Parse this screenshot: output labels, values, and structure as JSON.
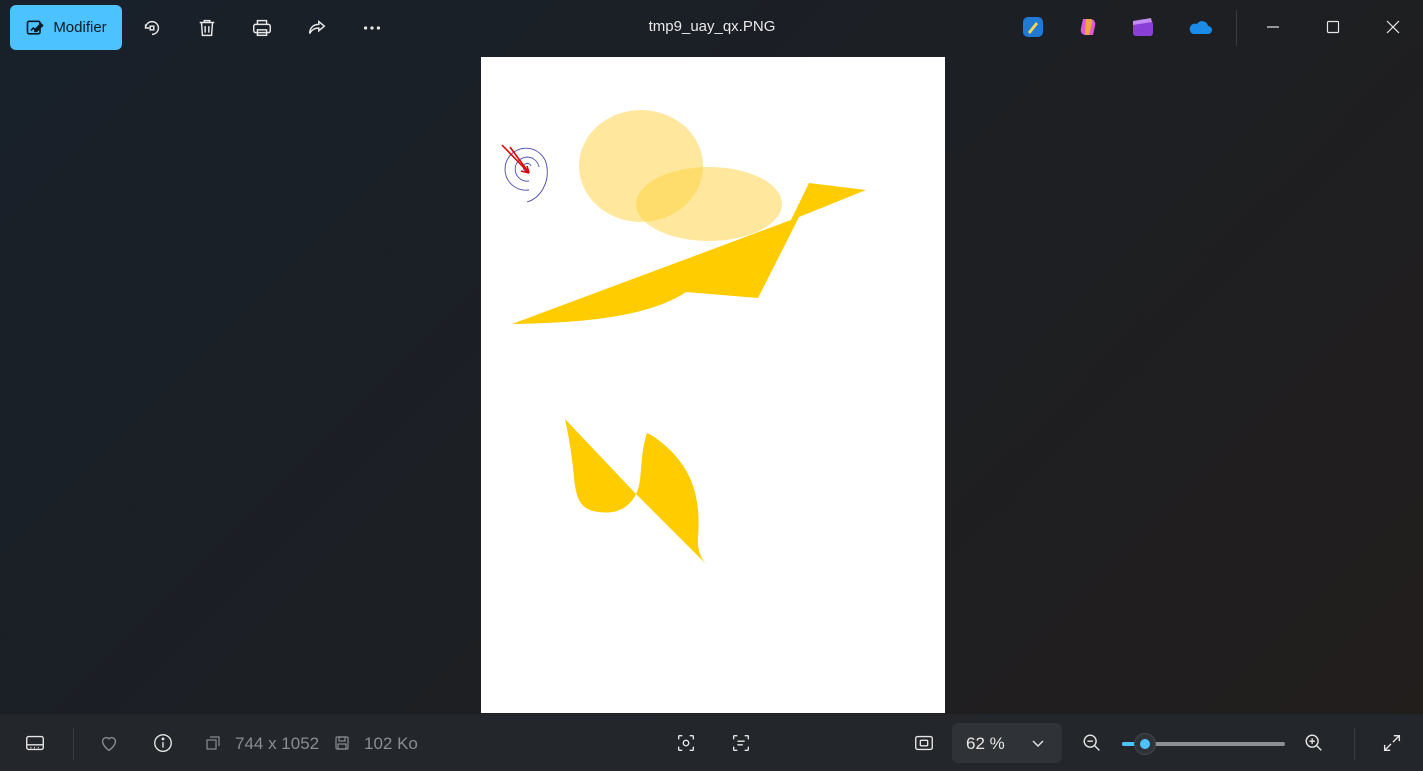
{
  "toolbar": {
    "edit_label": "Modifier",
    "filename": "tmp9_uay_qx.PNG"
  },
  "status": {
    "dimensions": "744 x 1052",
    "file_size": "102 Ko",
    "zoom": "62 %",
    "zoom_fraction": 0.14
  },
  "colors": {
    "accent": "#4cc2ff",
    "shape_yellow": "#ffcc00",
    "ellipse_fill": "#ffe58a",
    "spiral": "#4a4ab0",
    "arrow": "#e00000"
  },
  "icons": [
    "edit-image-icon",
    "rotate-icon",
    "delete-icon",
    "print-icon",
    "share-icon",
    "more-icon",
    "paint-app-icon",
    "copilot-app-icon",
    "clipchamp-app-icon",
    "onedrive-icon",
    "minimize-icon",
    "maximize-icon",
    "close-icon",
    "filmstrip-icon",
    "favorite-icon",
    "info-icon",
    "resolution-icon",
    "disk-icon",
    "visual-search-icon",
    "text-scan-icon",
    "fit-to-window-icon",
    "chevron-down-icon",
    "zoom-out-icon",
    "zoom-in-icon",
    "fullscreen-icon"
  ]
}
